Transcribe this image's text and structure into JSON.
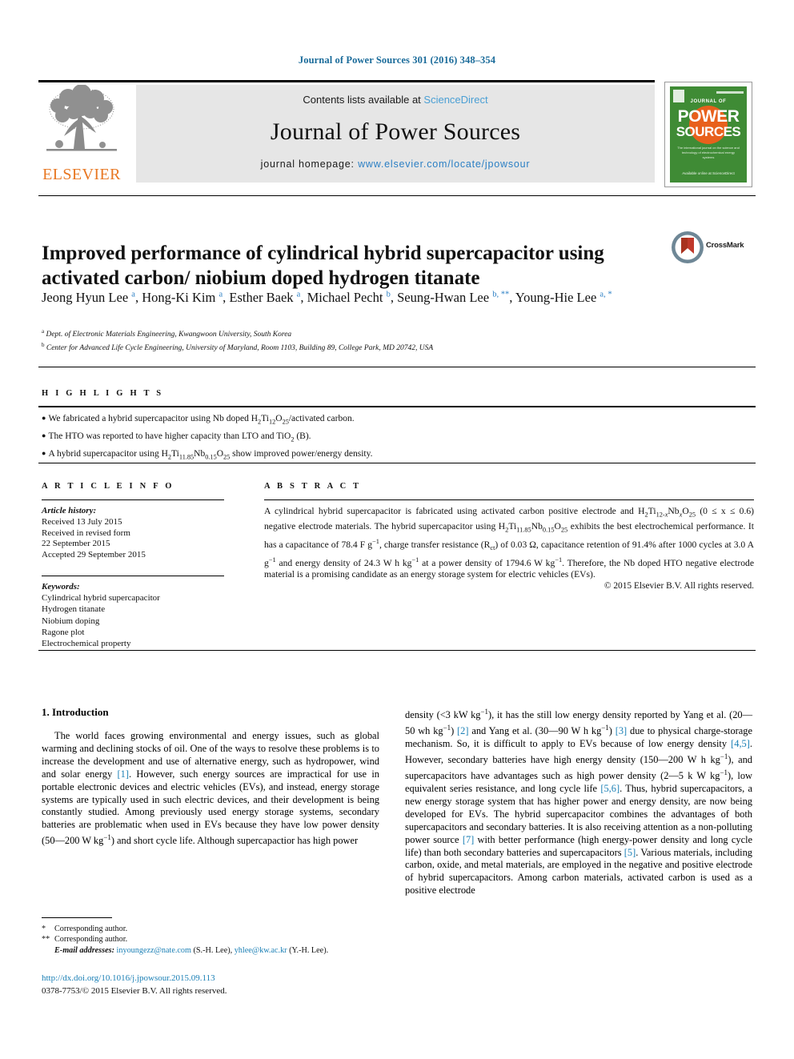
{
  "running_head": "Journal of Power Sources 301 (2016) 348–354",
  "masthead": {
    "contents_prefix": "Contents lists available at ",
    "sciencedirect": "ScienceDirect",
    "journal_title": "Journal of Power Sources",
    "homepage_label": "journal homepage: ",
    "homepage_url": "www.elsevier.com/locate/jpowsour",
    "publisher_wordmark": "ELSEVIER",
    "cover": {
      "journal_of": "JOURNAL OF",
      "power": "POWER",
      "sources": "SOURCES",
      "blurb": "The international journal on the science and technology of electrochemical energy systems",
      "foot": "Available online at\nScienceDirect"
    },
    "accent_orange": "#e87722",
    "accent_blue": "#2b7fc4",
    "cover_green": "#3f8b35",
    "panel_gray": "#e6e6e6"
  },
  "article": {
    "title": "Improved performance of cylindrical hybrid supercapacitor using activated carbon/ niobium doped hydrogen titanate",
    "crossmark_label": "CrossMark",
    "authors": [
      {
        "name": "Jeong Hyun Lee",
        "marks": "a"
      },
      {
        "name": "Hong-Ki Kim",
        "marks": "a"
      },
      {
        "name": "Esther Baek",
        "marks": "a"
      },
      {
        "name": "Michael Pecht",
        "marks": "b"
      },
      {
        "name": "Seung-Hwan Lee",
        "marks": "b, **"
      },
      {
        "name": "Young-Hie Lee",
        "marks": "a, *"
      }
    ],
    "affiliations": [
      {
        "mark": "a",
        "text": "Dept. of Electronic Materials Engineering, Kwangwoon University, South Korea"
      },
      {
        "mark": "b",
        "text": "Center for Advanced Life Cycle Engineering, University of Maryland, Room 1103, Building 89, College Park, MD 20742, USA"
      }
    ]
  },
  "highlights": {
    "heading": "H I G H L I G H T S",
    "items": [
      "We fabricated a hybrid supercapacitor using Nb doped H2Ti12O25/activated carbon.",
      "The HTO was reported to have higher capacity than LTO and TiO2 (B).",
      "A hybrid supercapacitor using H2Ti11.85Nb0.15O25 show improved power/energy density."
    ]
  },
  "article_info": {
    "heading": "A R T I C L E   I N F O",
    "history_label": "Article history:",
    "history": [
      "Received 13 July 2015",
      "Received in revised form",
      "22 September 2015",
      "Accepted 29 September 2015"
    ],
    "keywords_label": "Keywords:",
    "keywords": [
      "Cylindrical hybrid supercapacitor",
      "Hydrogen titanate",
      "Niobium doping",
      "Ragone plot",
      "Electrochemical property"
    ]
  },
  "abstract": {
    "heading": "A B S T R A C T",
    "text": "A cylindrical hybrid supercapacitor is fabricated using activated carbon positive electrode and H2Ti12-xNbxO25 (0 ≤ x ≤ 0.6) negative electrode materials. The hybrid supercapacitor using H2Ti11.85Nb0.15O25 exhibits the best electrochemical performance. It has a capacitance of 78.4 F g−1, charge transfer resistance (Rct) of 0.03 Ω, capacitance retention of 91.4% after 1000 cycles at 3.0 A g−1 and energy density of 24.3 W h kg−1 at a power density of 1794.6 W kg−1. Therefore, the Nb doped HTO negative electrode material is a promising candidate as an energy storage system for electric vehicles (EVs).",
    "copyright": "© 2015 Elsevier B.V. All rights reserved."
  },
  "body": {
    "section_number_title": "1.  Introduction",
    "left_paragraph": "The world faces growing environmental and energy issues, such as global warming and declining stocks of oil. One of the ways to resolve these problems is to increase the development and use of alternative energy, such as hydropower, wind and solar energy [1]. However, such energy sources are impractical for use in portable electronic devices and electric vehicles (EVs), and instead, energy storage systems are typically used in such electric devices, and their development is being constantly studied. Among previously used energy storage systems, secondary batteries are problematic when used in EVs because they have low power density (50—200 W kg−1) and short cycle life. Although supercapactior has high power",
    "right_paragraph": "density (<3 kW kg−1), it has the still low energy density reported by Yang et al. (20—50 wh kg−1) [2] and Yang et al. (30—90 W h kg−1) [3] due to physical charge-storage mechanism. So, it is difficult to apply to EVs because of low energy density [4,5]. However, secondary batteries have high energy density (150—200 W h kg−1), and supercapacitors have advantages such as high power density (2—5 k W kg−1), low equivalent series resistance, and long cycle life [5,6]. Thus, hybrid supercapacitors, a new energy storage system that has higher power and energy density, are now being developed for EVs. The hybrid supercapacitor combines the advantages of both supercapacitors and secondary batteries. It is also receiving attention as a non-polluting power source [7] with better performance (high energy-power density and long cycle life) than both secondary batteries and supercapacitors [5]. Various materials, including carbon, oxide, and metal materials, are employed in the negative and positive electrode of hybrid supercapacitors. Among carbon materials, activated carbon is used as a positive electrode"
  },
  "footnotes": {
    "corresponding_1": "Corresponding author.",
    "corresponding_2": "Corresponding author.",
    "email_label": "E-mail addresses:",
    "email_1": "inyoungezz@nate.com",
    "email_1_owner": "(S.-H. Lee),",
    "email_2": "yhlee@kw.ac.kr",
    "email_2_owner": "(Y.-H. Lee).",
    "doi": "http://dx.doi.org/10.1016/j.jpowsour.2015.09.113",
    "issn": "0378-7753/© 2015 Elsevier B.V. All rights reserved."
  }
}
